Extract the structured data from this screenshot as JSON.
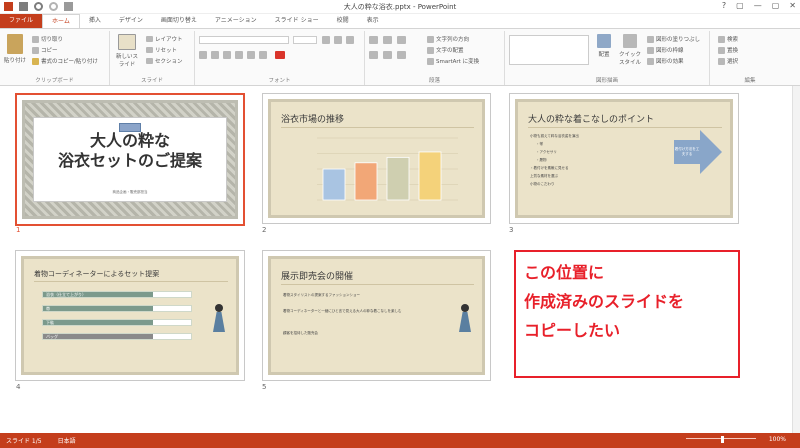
{
  "window": {
    "title": "大人の粋な浴衣.pptx - PowerPoint",
    "controls": [
      "?",
      "▢",
      "—",
      "▢",
      "✕"
    ]
  },
  "tabs": [
    {
      "label": "ファイル",
      "kind": "file"
    },
    {
      "label": "ホーム",
      "kind": "active"
    },
    {
      "label": "挿入",
      "kind": ""
    },
    {
      "label": "デザイン",
      "kind": ""
    },
    {
      "label": "画面切り替え",
      "kind": ""
    },
    {
      "label": "アニメーション",
      "kind": ""
    },
    {
      "label": "スライド ショー",
      "kind": ""
    },
    {
      "label": "校閲",
      "kind": ""
    },
    {
      "label": "表示",
      "kind": ""
    }
  ],
  "ribbon": {
    "clipboard": {
      "label": "クリップボード",
      "paste": "貼り付け",
      "cut": "切り取り",
      "copy": "コピー",
      "format_painter": "書式のコピー/貼り付け"
    },
    "slides": {
      "label": "スライド",
      "new_slide": "新しいスライド",
      "layout": "レイアウト",
      "reset": "リセット",
      "section": "セクション"
    },
    "font": {
      "label": "フォント"
    },
    "paragraph": {
      "label": "段落",
      "text_direction": "文字列の方向",
      "align_text": "文字の配置",
      "smartart": "SmartArt に変換"
    },
    "drawing": {
      "label": "図形描画",
      "arrange": "配置",
      "quick_styles": "クイック スタイル",
      "fill": "図形の塗りつぶし",
      "outline": "図形の枠線",
      "effects": "図形の効果"
    },
    "editing": {
      "label": "編集",
      "find": "検索",
      "replace": "置換",
      "select": "選択"
    }
  },
  "slides": [
    {
      "number": "1",
      "title": "大人の粋な\n浴衣セットのご提案",
      "subtitle": "商品企画・販売部担当"
    },
    {
      "number": "2",
      "title": "浴衣市場の推移"
    },
    {
      "number": "3",
      "title": "大人の粋な着こなしのポイント",
      "bullets": [
        "小物も揃えて粋な浴衣姿を演出",
        "・帯",
        "・アクセサリ",
        "・履物",
        "・着付けを素敵に見せる",
        "上質な素材を選ぶ",
        "小物のこだわり"
      ],
      "arrow_text": "着付け方法を工夫する"
    },
    {
      "number": "4",
      "title": "着物コーディネーターによるセット提案",
      "items": [
        "浴衣（仕立て上がり）",
        "帯",
        "下駄",
        "バッグ"
      ]
    },
    {
      "number": "5",
      "title": "展示即売会の開催",
      "bullets": [
        "着物スタイリストの提案するファッションショー",
        "着物コーディネーターと一緒にひと言で見える大人の粋な着こなしを楽しむ",
        "顧客を招待した販売会"
      ]
    }
  ],
  "chart_data": {
    "type": "bar",
    "categories": [
      "",
      "",
      "",
      ""
    ],
    "series": [
      {
        "values": [
          40,
          48,
          55,
          62
        ]
      }
    ],
    "colors": [
      "#a9c4e2",
      "#f2a777",
      "#cfcfb0",
      "#f4d27a"
    ],
    "ylim": [
      0,
      80
    ]
  },
  "callout": {
    "lines": [
      "この位置に",
      "作成済みのスライドを",
      "コピーしたい"
    ],
    "color": "#e8202a"
  },
  "status": {
    "slide_info": "スライド 1/5",
    "language": "日本語",
    "zoom": "100%"
  },
  "colors": {
    "accent": "#c43e1c",
    "selection": "#e35032"
  }
}
